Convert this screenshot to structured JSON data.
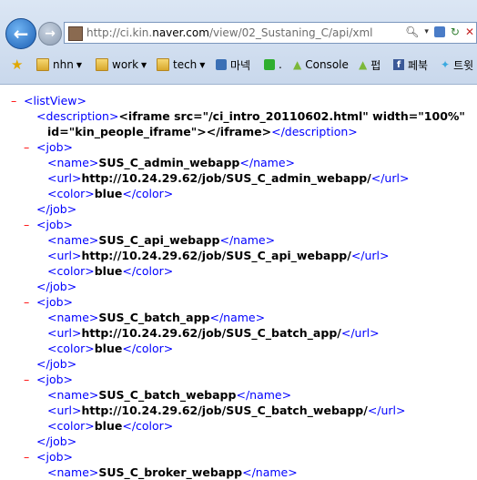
{
  "browser": {
    "url_prefix": "http://ci.kin.",
    "url_host": "naver.com",
    "url_suffix": "/view/02_Sustaning_C/api/xml",
    "favorites": [
      {
        "label": "nhn",
        "type": "folder"
      },
      {
        "label": "work",
        "type": "folder"
      },
      {
        "label": "tech",
        "type": "folder"
      },
      {
        "label": "마넥",
        "type": "site"
      },
      {
        "label": ".",
        "type": "site"
      },
      {
        "label": "Console",
        "type": "site"
      },
      {
        "label": "펍",
        "type": "site"
      },
      {
        "label": "페북",
        "type": "site"
      },
      {
        "label": "트윗",
        "type": "site"
      }
    ]
  },
  "xml": {
    "minus": "–",
    "root_open": "<listView>",
    "desc_open": "<description>",
    "desc_val1": "<iframe src=\"/ci_intro_20110602.html\" width=\"100%\"",
    "desc_val2": "id=\"kin_people_iframe\"></iframe>",
    "desc_close": "</description>",
    "job_open": "<job>",
    "job_close": "</job>",
    "name_open": "<name>",
    "name_close": "</name>",
    "url_open": "<url>",
    "url_close": "</url>",
    "color_open": "<color>",
    "color_close": "</color>",
    "jobs": [
      {
        "name": "SUS_C_admin_webapp",
        "url": "http://10.24.29.62/job/SUS_C_admin_webapp/",
        "color": "blue"
      },
      {
        "name": "SUS_C_api_webapp",
        "url": "http://10.24.29.62/job/SUS_C_api_webapp/",
        "color": "blue"
      },
      {
        "name": "SUS_C_batch_app",
        "url": "http://10.24.29.62/job/SUS_C_batch_app/",
        "color": "blue"
      },
      {
        "name": "SUS_C_batch_webapp",
        "url": "http://10.24.29.62/job/SUS_C_batch_webapp/",
        "color": "blue"
      },
      {
        "name": "SUS_C_broker_webapp"
      }
    ]
  }
}
